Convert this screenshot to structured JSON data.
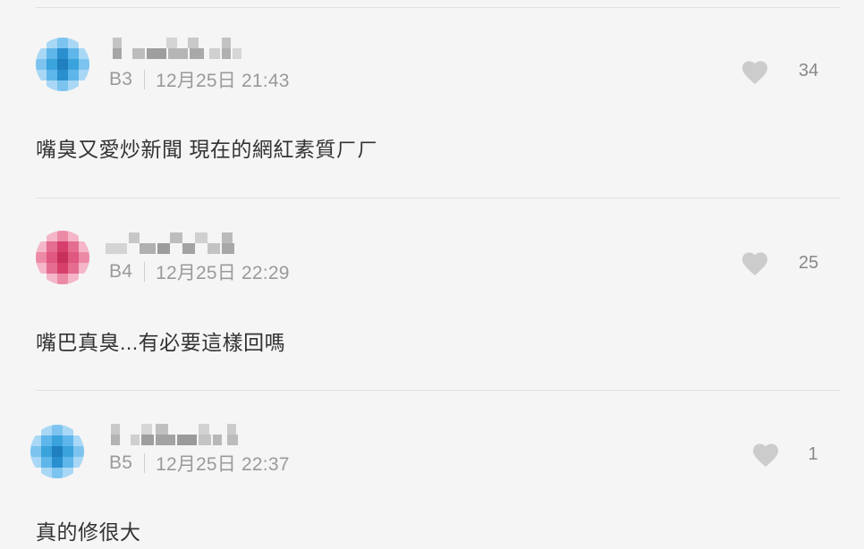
{
  "comments": [
    {
      "floor": "B3",
      "time": "12月25日 21:43",
      "likes": "34",
      "content": "嘴臭又愛炒新聞 現在的網紅素質ㄏㄏ",
      "avatar_color": "#3aa3dc"
    },
    {
      "floor": "B4",
      "time": "12月25日 22:29",
      "likes": "25",
      "content": "嘴巴真臭...有必要這樣回嗎",
      "avatar_color": "#e0577f"
    },
    {
      "floor": "B5",
      "time": "12月25日 22:37",
      "likes": "1",
      "content": "真的修很大",
      "avatar_color": "#3aa3dc"
    }
  ],
  "colors": {
    "background": "#f5f5f5",
    "text": "#333333",
    "meta_text": "#9a9a9a",
    "heart": "#cccccc",
    "divider": "#e0e0e0"
  },
  "icons": {
    "like": "heart-icon"
  }
}
